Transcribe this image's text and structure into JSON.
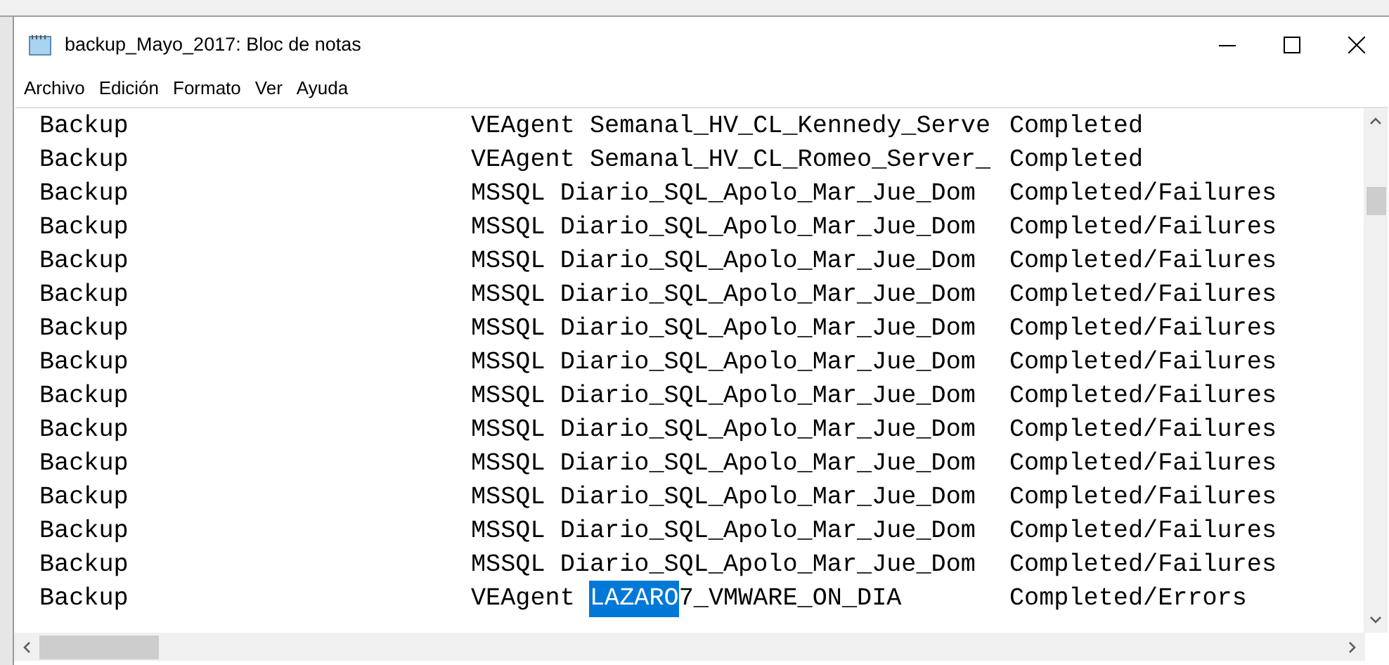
{
  "window": {
    "title": "backup_Mayo_2017: Bloc de notas"
  },
  "menu": [
    "Archivo",
    "Edición",
    "Formato",
    "Ver",
    "Ayuda"
  ],
  "lines": [
    {
      "column_1": "Backup",
      "column_2": [
        {
          "text": "VEAgent Semanal_HV_CL_Kennedy_Serve",
          "selected": false
        }
      ],
      "column_3": "Completed"
    },
    {
      "column_1": "Backup",
      "column_2": [
        {
          "text": "VEAgent Semanal_HV_CL_Romeo_Server_",
          "selected": false
        }
      ],
      "column_3": "Completed"
    },
    {
      "column_1": "Backup",
      "column_2": [
        {
          "text": "MSSQL Diario_SQL_Apolo_Mar_Jue_Dom",
          "selected": false
        }
      ],
      "column_3": "Completed/Failures"
    },
    {
      "column_1": "Backup",
      "column_2": [
        {
          "text": "MSSQL Diario_SQL_Apolo_Mar_Jue_Dom",
          "selected": false
        }
      ],
      "column_3": "Completed/Failures"
    },
    {
      "column_1": "Backup",
      "column_2": [
        {
          "text": "MSSQL Diario_SQL_Apolo_Mar_Jue_Dom",
          "selected": false
        }
      ],
      "column_3": "Completed/Failures"
    },
    {
      "column_1": "Backup",
      "column_2": [
        {
          "text": "MSSQL Diario_SQL_Apolo_Mar_Jue_Dom",
          "selected": false
        }
      ],
      "column_3": "Completed/Failures"
    },
    {
      "column_1": "Backup",
      "column_2": [
        {
          "text": "MSSQL Diario_SQL_Apolo_Mar_Jue_Dom",
          "selected": false
        }
      ],
      "column_3": "Completed/Failures"
    },
    {
      "column_1": "Backup",
      "column_2": [
        {
          "text": "MSSQL Diario_SQL_Apolo_Mar_Jue_Dom",
          "selected": false
        }
      ],
      "column_3": "Completed/Failures"
    },
    {
      "column_1": "Backup",
      "column_2": [
        {
          "text": "MSSQL Diario_SQL_Apolo_Mar_Jue_Dom",
          "selected": false
        }
      ],
      "column_3": "Completed/Failures"
    },
    {
      "column_1": "Backup",
      "column_2": [
        {
          "text": "MSSQL Diario_SQL_Apolo_Mar_Jue_Dom",
          "selected": false
        }
      ],
      "column_3": "Completed/Failures"
    },
    {
      "column_1": "Backup",
      "column_2": [
        {
          "text": "MSSQL Diario_SQL_Apolo_Mar_Jue_Dom",
          "selected": false
        }
      ],
      "column_3": "Completed/Failures"
    },
    {
      "column_1": "Backup",
      "column_2": [
        {
          "text": "MSSQL Diario_SQL_Apolo_Mar_Jue_Dom",
          "selected": false
        }
      ],
      "column_3": "Completed/Failures"
    },
    {
      "column_1": "Backup",
      "column_2": [
        {
          "text": "MSSQL Diario_SQL_Apolo_Mar_Jue_Dom",
          "selected": false
        }
      ],
      "column_3": "Completed/Failures"
    },
    {
      "column_1": "Backup",
      "column_2": [
        {
          "text": "MSSQL Diario_SQL_Apolo_Mar_Jue_Dom",
          "selected": false
        }
      ],
      "column_3": "Completed/Failures"
    },
    {
      "column_1": "Backup",
      "column_2": [
        {
          "text": "VEAgent ",
          "selected": false
        },
        {
          "text": "LAZARO",
          "selected": true
        },
        {
          "text": "7_VMWARE_ON_DIA",
          "selected": false
        }
      ],
      "column_3": "Completed/Errors"
    }
  ]
}
